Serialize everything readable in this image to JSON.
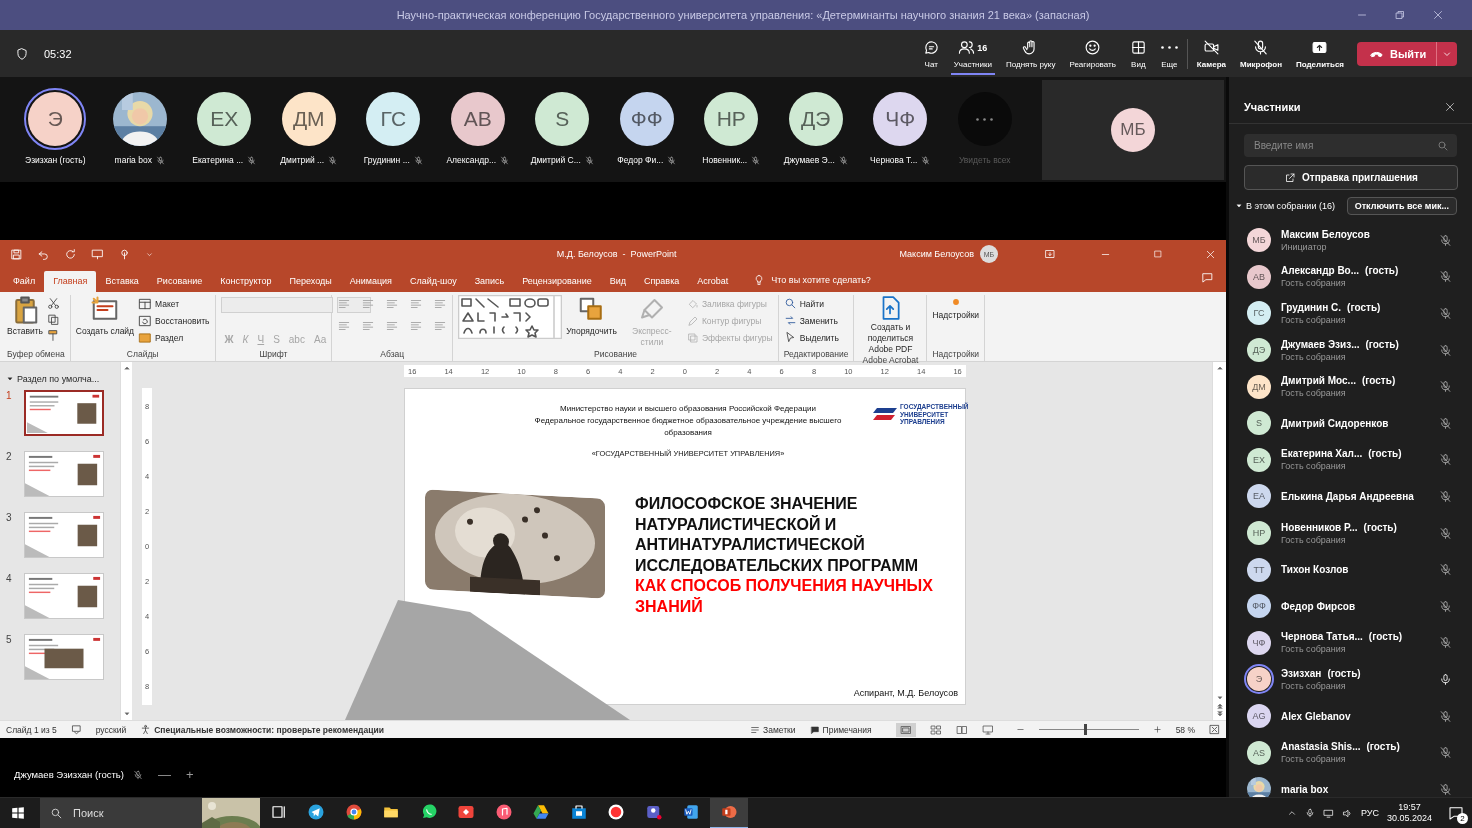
{
  "window": {
    "title": "Научно-практическая конференцию Государственного университета управления: «Детерминанты научного знания 21 века» (запасная)"
  },
  "meeting_bar": {
    "timer": "05:32",
    "actions": [
      {
        "kind": "chat",
        "label": "Чат",
        "selected": false
      },
      {
        "kind": "people",
        "label": "Участники",
        "count": "16",
        "selected": true
      },
      {
        "kind": "hand",
        "label": "Поднять руку",
        "selected": false
      },
      {
        "kind": "react",
        "label": "Реагировать",
        "selected": false
      },
      {
        "kind": "view",
        "label": "Вид",
        "selected": false
      },
      {
        "kind": "more",
        "label": "Еще",
        "selected": false
      }
    ],
    "devices": [
      {
        "kind": "camera",
        "label": "Камера",
        "on": false
      },
      {
        "kind": "mic",
        "label": "Микрофон",
        "on": false
      }
    ],
    "share": {
      "label": "Поделиться"
    },
    "leave": {
      "label": "Выйти"
    }
  },
  "video_tiles": [
    {
      "kind": "initials",
      "initials": "Э",
      "color": "#f6d2c8",
      "name": "Эзизхан (гость)",
      "speaking": true,
      "muted": false
    },
    {
      "name": "maria box",
      "speaking": false,
      "muted": true
    },
    {
      "kind": "initials",
      "initials": "ЕХ",
      "color": "#cfe9d3",
      "name": "Екатерина ...",
      "speaking": false,
      "muted": true
    },
    {
      "kind": "initials",
      "initials": "ДМ",
      "color": "#fde4c8",
      "name": "Дмитрий ...",
      "speaking": false,
      "muted": true
    },
    {
      "kind": "initials",
      "initials": "ГС",
      "color": "#d4eef3",
      "name": "Грудинин ...",
      "speaking": false,
      "muted": true
    },
    {
      "kind": "initials",
      "initials": "АВ",
      "color": "#e8c8cc",
      "name": "Александр...",
      "speaking": false,
      "muted": true
    },
    {
      "kind": "initials",
      "initials": "S",
      "color": "#cfe9d3",
      "name": "Дмитрий С...",
      "speaking": false,
      "muted": true
    },
    {
      "kind": "initials",
      "initials": "ФФ",
      "color": "#c5d5ef",
      "name": "Федор Фи...",
      "speaking": false,
      "muted": true
    },
    {
      "kind": "initials",
      "initials": "НР",
      "color": "#cfe9d3",
      "name": "Новенник...",
      "speaking": false,
      "muted": true
    },
    {
      "kind": "initials",
      "initials": "ДЭ",
      "color": "#cfe9d3",
      "name": "Джумаев Э...",
      "speaking": false,
      "muted": true
    },
    {
      "kind": "initials",
      "initials": "ЧФ",
      "color": "#ddd7ef",
      "name": "Чернова Т...",
      "speaking": false,
      "muted": true
    }
  ],
  "see_all": {
    "label": "Увидеть всех",
    "disabled": true
  },
  "stage_tile": {
    "initials": "МБ",
    "color": "#f3d6d8"
  },
  "powerpoint": {
    "title": "М.Д. Белоусов  -  PowerPoint",
    "user": "Максим Белоусов",
    "user_initials": "МБ",
    "tabs": [
      {
        "label": "Файл",
        "selected": false
      },
      {
        "label": "Главная",
        "selected": true
      },
      {
        "label": "Вставка",
        "selected": false
      },
      {
        "label": "Рисование",
        "selected": false
      },
      {
        "label": "Конструктор",
        "selected": false
      },
      {
        "label": "Переходы",
        "selected": false
      },
      {
        "label": "Анимация",
        "selected": false
      },
      {
        "label": "Слайд-шоу",
        "selected": false
      },
      {
        "label": "Запись",
        "selected": false
      },
      {
        "label": "Рецензирование",
        "selected": false
      },
      {
        "label": "Вид",
        "selected": false
      },
      {
        "label": "Справка",
        "selected": false
      },
      {
        "label": "Acrobat",
        "selected": false
      }
    ],
    "tell_me": "Что вы хотите сделать?",
    "ribbon": [
      {
        "label": "Буфер обмена",
        "items": [
          {
            "kind": "paste",
            "label": "Вставить"
          },
          {
            "kind": "clipboard-tools"
          }
        ]
      },
      {
        "label": "Слайды",
        "items": [
          {
            "kind": "new-slide",
            "label": "Создать слайд"
          },
          {
            "kind": "layout",
            "label": "Макет"
          },
          {
            "kind": "reset",
            "label": "Восстановить"
          },
          {
            "kind": "section",
            "label": "Раздел"
          }
        ]
      },
      {
        "label": "Шрифт",
        "items": [
          {
            "kind": "font-fields",
            "disabled": true
          },
          {
            "kind": "glyphs",
            "glyphs": [
              "Ж",
              "К",
              "Ч",
              "S",
              "abc",
              "Аа"
            ],
            "disabled": true
          }
        ]
      },
      {
        "label": "Абзац",
        "items": [
          {
            "kind": "paragraph-tools",
            "disabled": true
          }
        ]
      },
      {
        "label": "Рисование",
        "items": [
          {
            "kind": "shapes"
          },
          {
            "kind": "arrange",
            "label": "Упорядочить"
          },
          {
            "kind": "quick-styles",
            "label": "Экспресс-стили",
            "disabled": true
          },
          {
            "kind": "fill",
            "label": "Заливка фигуры",
            "disabled": true
          },
          {
            "kind": "outline",
            "label": "Контур фигуры",
            "disabled": true
          },
          {
            "kind": "effects",
            "label": "Эффекты фигуры",
            "disabled": true
          }
        ]
      },
      {
        "label": "Редактирование",
        "items": [
          {
            "kind": "find",
            "label": "Найти"
          },
          {
            "kind": "replace",
            "label": "Заменить"
          },
          {
            "kind": "select",
            "label": "Выделить"
          }
        ]
      },
      {
        "label": "Adobe Acrobat",
        "items": [
          {
            "kind": "pdf",
            "label": "Создать и поделиться Adobe PDF"
          }
        ]
      },
      {
        "label": "Надстройки",
        "items": [
          {
            "kind": "addins",
            "label": "Надстройки"
          }
        ]
      }
    ],
    "slides_panel": {
      "section": "Раздел по умолча...",
      "expanded": true,
      "thumbnails": [
        {
          "number": "1",
          "selected": true
        },
        {
          "number": "2",
          "selected": false
        },
        {
          "number": "3",
          "selected": false
        },
        {
          "number": "4",
          "selected": false
        },
        {
          "number": "5",
          "selected": false
        }
      ]
    },
    "ruler": {
      "horizontal": [
        "16",
        "14",
        "12",
        "10",
        "8",
        "6",
        "4",
        "2",
        "0",
        "2",
        "4",
        "6",
        "8",
        "10",
        "12",
        "14",
        "16"
      ],
      "vertical": [
        "8",
        "6",
        "4",
        "2",
        "0",
        "2",
        "4",
        "6",
        "8"
      ]
    },
    "slide": {
      "header": [
        "Министерство науки и высшего образования Российской Федерации",
        "Федеральное государственное бюджетное образовательное учреждение высшего образования"
      ],
      "university": "«ГОСУДАРСТВЕННЫЙ УНИВЕРСИТЕТ УПРАВЛЕНИЯ»",
      "logo_text": "ГОСУДАРСТВЕННЫЙ УНИВЕРСИТЕТ УПРАВЛЕНИЯ",
      "title": "ФИЛОСОФСКОЕ ЗНАЧЕНИЕ НАТУРАЛИСТИЧЕСКОЙ И АНТИНАТУРАЛИСТИЧЕСКОЙ ИССЛЕДОВАТЕЛЬСКИХ ПРОГРАММ",
      "subtitle": "КАК СПОСОБ ПОЛУЧЕНИЯ НАУЧНЫХ ЗНАНИЙ",
      "author": "Аспирант, М.Д. Белоусов"
    },
    "status": {
      "slide_counter": "Слайд 1 из 5",
      "language": "русский",
      "accessibility": "Специальные возможности: проверьте рекомендации",
      "notes": "Заметки",
      "comments": "Примечания",
      "zoom": "58 %",
      "zoom_slider": {
        "level": 0.47
      }
    }
  },
  "presenter": {
    "name": "Джумаев Эзизхан (гость)",
    "muted": true,
    "controls": [
      "—",
      "+"
    ]
  },
  "panel": {
    "title": "Участники",
    "search_placeholder": "Введите имя",
    "invite": "Отправка приглашения",
    "section": {
      "label": "В этом собрании (16)",
      "expanded": true
    },
    "mute_all": "Отключить все мик...",
    "participants": [
      {
        "kind": "initials",
        "initials": "МБ",
        "color": "#f3d6d8",
        "name": "Максим Белоусов",
        "role": "Инициатор",
        "speaking": false,
        "muted": true
      },
      {
        "kind": "initials",
        "initials": "АВ",
        "color": "#e8c8cc",
        "name": "Александр Во...",
        "tag": "(гость)",
        "role": "Гость собрания",
        "speaking": false,
        "muted": true
      },
      {
        "kind": "initials",
        "initials": "ГС",
        "color": "#d4eef3",
        "name": "Грудинин С.",
        "tag": "(гость)",
        "role": "Гость собрания",
        "speaking": false,
        "muted": true
      },
      {
        "kind": "initials",
        "initials": "ДЭ",
        "color": "#cfe9d3",
        "name": "Джумаев Эзиз...",
        "tag": "(гость)",
        "role": "Гость собрания",
        "speaking": false,
        "muted": true
      },
      {
        "kind": "initials",
        "initials": "ДМ",
        "color": "#fde4c8",
        "name": "Дмитрий Мос...",
        "tag": "(гость)",
        "role": "Гость собрания",
        "speaking": false,
        "muted": true
      },
      {
        "kind": "initials",
        "initials": "S",
        "color": "#cfe9d3",
        "name": "Дмитрий Сидоренков",
        "speaking": false,
        "muted": true
      },
      {
        "kind": "initials",
        "initials": "ЕХ",
        "color": "#cfe9d3",
        "name": "Екатерина Хал...",
        "tag": "(гость)",
        "role": "Гость собрания",
        "speaking": false,
        "muted": true
      },
      {
        "kind": "initials",
        "initials": "ЕА",
        "color": "#cdd8ee",
        "name": "Елькина Дарья Андреевна",
        "speaking": false,
        "muted": true
      },
      {
        "kind": "initials",
        "initials": "НР",
        "color": "#cfe9d3",
        "name": "Новенников Р...",
        "tag": "(гость)",
        "role": "Гость собрания",
        "speaking": false,
        "muted": true
      },
      {
        "kind": "initials",
        "initials": "ТТ",
        "color": "#cdd8ee",
        "name": "Тихон Козлов",
        "speaking": false,
        "muted": true
      },
      {
        "kind": "initials",
        "initials": "ФФ",
        "color": "#c5d5ef",
        "name": "Федор Фирсов",
        "speaking": false,
        "muted": true
      },
      {
        "kind": "initials",
        "initials": "ЧФ",
        "color": "#ddd7ef",
        "name": "Чернова Татья...",
        "tag": "(гость)",
        "role": "Гость собрания",
        "speaking": false,
        "muted": true
      },
      {
        "kind": "initials",
        "initials": "Э",
        "color": "#f6d2c8",
        "name": "Эзизхан",
        "tag": "(гость)",
        "role": "Гость собрания",
        "speaking": true,
        "muted": false
      },
      {
        "kind": "initials",
        "initials": "AG",
        "color": "#dad5f0",
        "name": "Alex Glebanov",
        "speaking": false,
        "muted": true
      },
      {
        "kind": "initials",
        "initials": "AS",
        "color": "#cfe9d3",
        "name": "Anastasia Shis...",
        "tag": "(гость)",
        "role": "Гость собрания",
        "speaking": false,
        "muted": true
      },
      {
        "name": "maria box",
        "speaking": false,
        "muted": true
      }
    ]
  },
  "taskbar": {
    "search": "Поиск",
    "apps": [
      {
        "kind": "task-view",
        "selected": false
      },
      {
        "kind": "telegram",
        "selected": false
      },
      {
        "kind": "chrome",
        "selected": false
      },
      {
        "kind": "explorer",
        "selected": false
      },
      {
        "kind": "whatsapp",
        "selected": false
      },
      {
        "kind": "anydesk",
        "selected": false
      },
      {
        "kind": "music",
        "selected": false
      },
      {
        "kind": "drive",
        "selected": false
      },
      {
        "kind": "store",
        "selected": false
      },
      {
        "kind": "yandex",
        "selected": false
      },
      {
        "kind": "teams",
        "selected": false
      },
      {
        "kind": "word",
        "selected": false
      },
      {
        "kind": "powerpoint",
        "selected": true
      }
    ],
    "language": "РУС",
    "time": "19:57",
    "date": "30.05.2024",
    "notifications": "2"
  }
}
